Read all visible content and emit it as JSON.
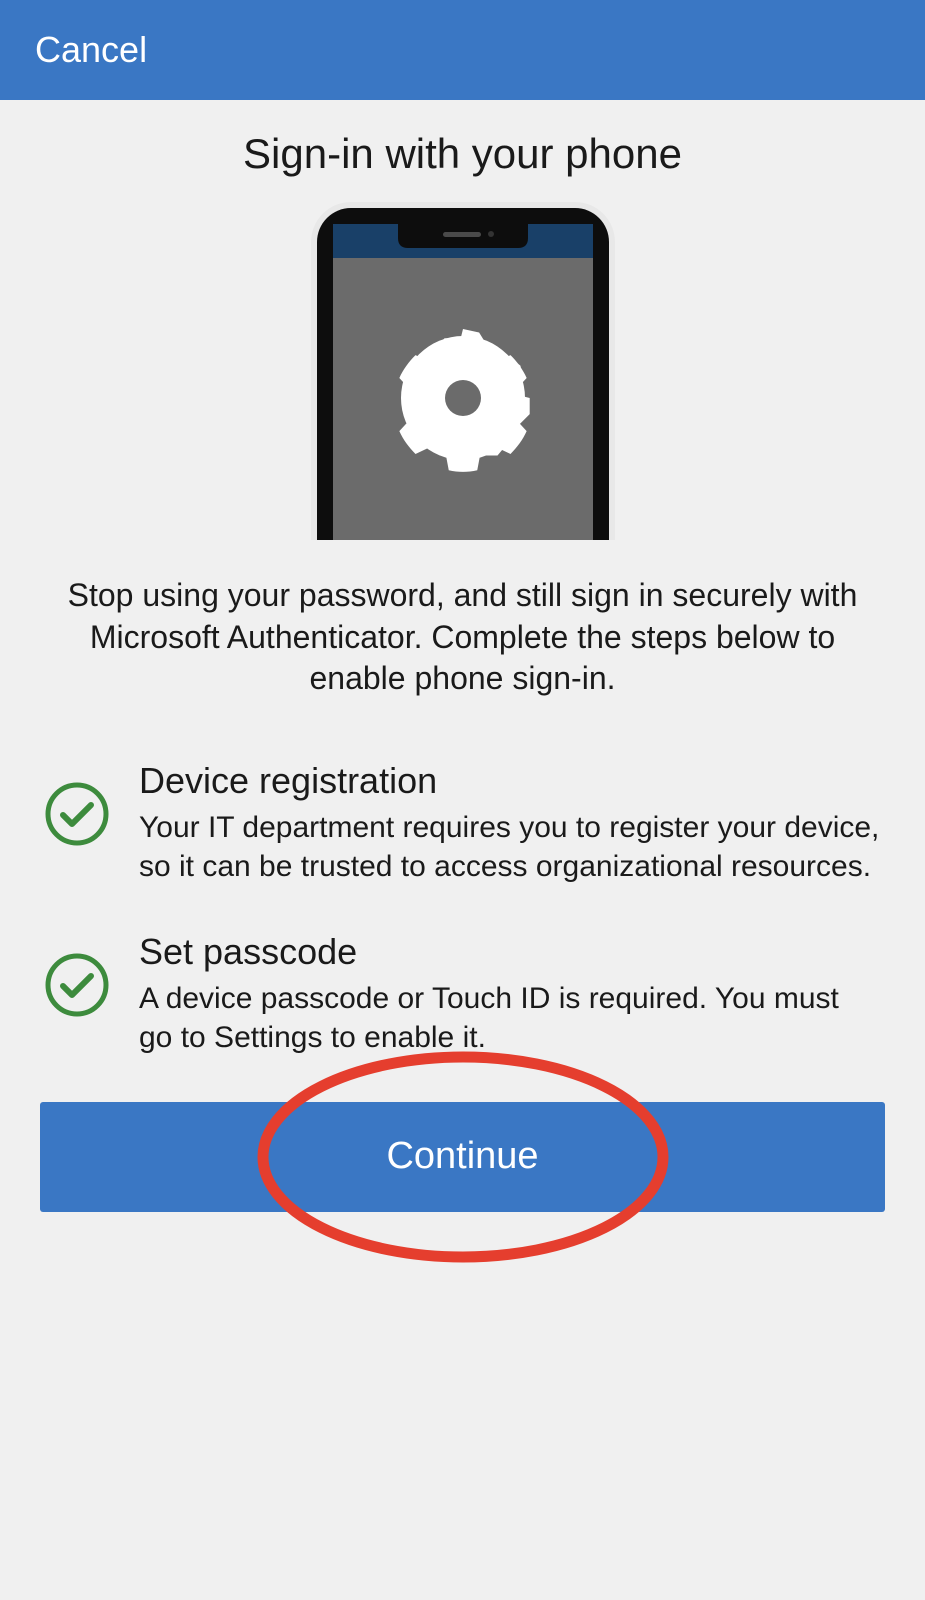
{
  "header": {
    "cancel_label": "Cancel"
  },
  "main": {
    "title": "Sign-in with your phone",
    "description": "Stop using your password, and still sign in securely with Microsoft Authenticator. Complete the steps below to enable phone sign-in.",
    "steps": [
      {
        "title": "Device registration",
        "description": "Your IT department requires you to register your device, so it can be trusted to access organizational resources."
      },
      {
        "title": "Set passcode",
        "description": "A device passcode or Touch ID is required. You must go to Settings to enable it."
      }
    ],
    "continue_label": "Continue"
  },
  "colors": {
    "primary": "#3a77c4",
    "check_green": "#3d8b3d",
    "highlight_red": "#e53e2e"
  }
}
